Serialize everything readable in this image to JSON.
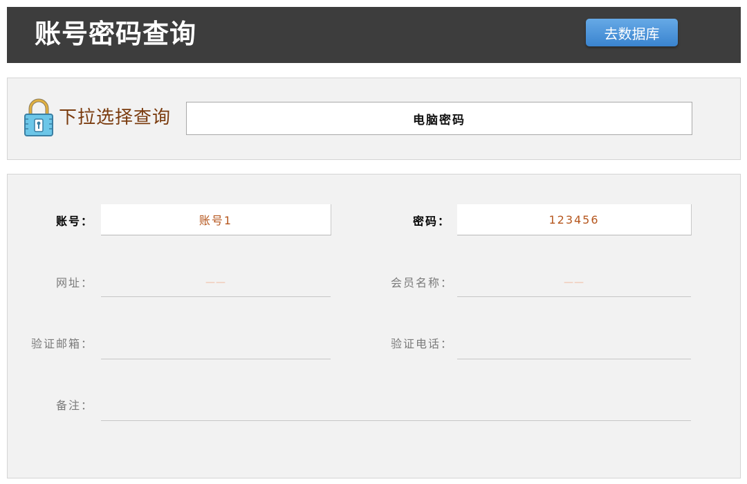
{
  "header": {
    "title": "账号密码查询",
    "db_button_label": "去数据库"
  },
  "selector": {
    "icon": "lock-icon",
    "label": "下拉选择查询",
    "selected_value": "电脑密码"
  },
  "details": {
    "account_label": "账号：",
    "account_value": "账号1",
    "password_label": "密码：",
    "password_value": "123456",
    "website_label": "网址：",
    "website_value": "——",
    "member_name_label": "会员名称：",
    "member_name_value": "——",
    "email_label": "验证邮箱：",
    "email_value": "",
    "phone_label": "验证电话：",
    "phone_value": "",
    "note_label": "备注：",
    "note_value": ""
  },
  "colors": {
    "header_bg": "#3d3d3d",
    "button_blue": "#4a93da",
    "label_brown": "#7a3b0e",
    "value_orange": "#b5561d"
  }
}
